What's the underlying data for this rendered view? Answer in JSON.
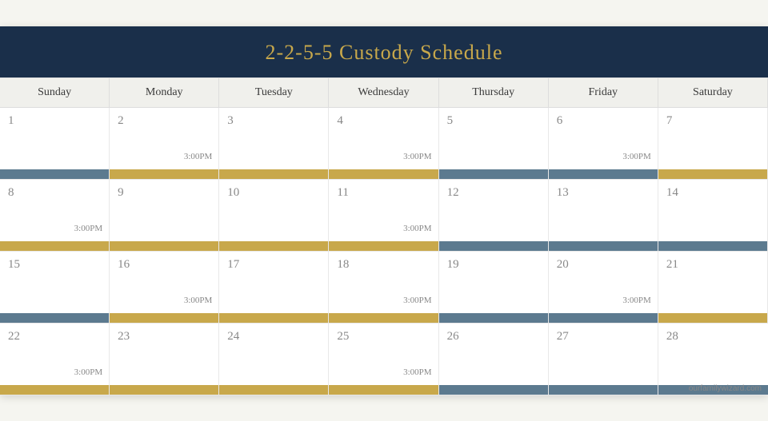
{
  "title": "2-2-5-5 Custody Schedule",
  "days": [
    "Sunday",
    "Monday",
    "Tuesday",
    "Wednesday",
    "Thursday",
    "Friday",
    "Saturday"
  ],
  "weeks": [
    {
      "cells": [
        {
          "num": "1",
          "time": null,
          "bar": "blue"
        },
        {
          "num": "2",
          "time": "3:00PM",
          "bar": "gold"
        },
        {
          "num": "3",
          "time": null,
          "bar": "gold"
        },
        {
          "num": "4",
          "time": "3:00PM",
          "bar": "gold"
        },
        {
          "num": "5",
          "time": null,
          "bar": "blue"
        },
        {
          "num": "6",
          "time": "3:00PM",
          "bar": "blue"
        },
        {
          "num": "7",
          "time": null,
          "bar": "gold"
        }
      ]
    },
    {
      "cells": [
        {
          "num": "8",
          "time": "3:00PM",
          "bar": "gold"
        },
        {
          "num": "9",
          "time": null,
          "bar": "gold"
        },
        {
          "num": "10",
          "time": null,
          "bar": "gold"
        },
        {
          "num": "11",
          "time": "3:00PM",
          "bar": "gold"
        },
        {
          "num": "12",
          "time": null,
          "bar": "blue"
        },
        {
          "num": "13",
          "time": null,
          "bar": "blue"
        },
        {
          "num": "14",
          "time": null,
          "bar": "blue"
        }
      ]
    },
    {
      "cells": [
        {
          "num": "15",
          "time": null,
          "bar": "blue"
        },
        {
          "num": "16",
          "time": "3:00PM",
          "bar": "gold"
        },
        {
          "num": "17",
          "time": null,
          "bar": "gold"
        },
        {
          "num": "18",
          "time": "3:00PM",
          "bar": "gold"
        },
        {
          "num": "19",
          "time": null,
          "bar": "blue"
        },
        {
          "num": "20",
          "time": "3:00PM",
          "bar": "blue"
        },
        {
          "num": "21",
          "time": null,
          "bar": "gold"
        }
      ]
    },
    {
      "cells": [
        {
          "num": "22",
          "time": "3:00PM",
          "bar": "gold"
        },
        {
          "num": "23",
          "time": null,
          "bar": "gold"
        },
        {
          "num": "24",
          "time": null,
          "bar": "gold"
        },
        {
          "num": "25",
          "time": "3:00PM",
          "bar": "gold"
        },
        {
          "num": "26",
          "time": null,
          "bar": "blue"
        },
        {
          "num": "27",
          "time": null,
          "bar": "blue"
        },
        {
          "num": "28",
          "time": null,
          "bar": "blue"
        }
      ]
    }
  ],
  "watermark": "ourfamilywizard.com"
}
